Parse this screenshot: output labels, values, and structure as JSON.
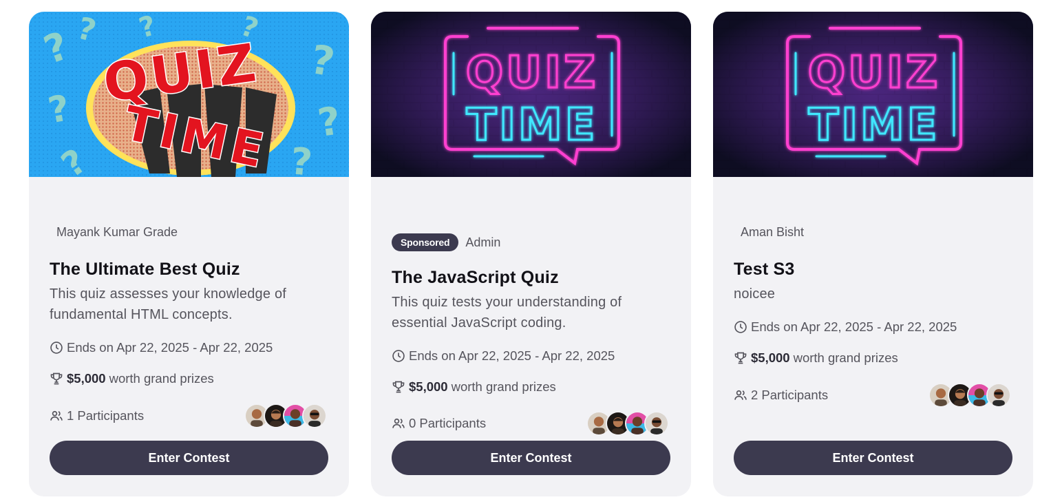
{
  "cards": [
    {
      "banner_style": "comic-blue",
      "banner_text_top": "QUIZ",
      "banner_text_bottom": "TIME",
      "sponsored": false,
      "sponsored_label": "",
      "author": "Mayank Kumar Grade",
      "title": "The Ultimate Best Quiz",
      "description": "This quiz assesses your knowledge of fundamental HTML concepts.",
      "ends_label": "Ends on Apr 22, 2025 - Apr 22, 2025",
      "prize_amount": "$5,000",
      "prize_suffix": "worth grand prizes",
      "participants_label": "1 Participants",
      "cta_label": "Enter Contest"
    },
    {
      "banner_style": "neon-brick",
      "banner_text_top": "QUIZ",
      "banner_text_bottom": "TIME",
      "sponsored": true,
      "sponsored_label": "Sponsored",
      "author": "Admin",
      "title": "The JavaScript Quiz",
      "description": "This quiz tests your understanding of essential JavaScript coding.",
      "ends_label": "Ends on Apr 22, 2025 - Apr 22, 2025",
      "prize_amount": "$5,000",
      "prize_suffix": "worth grand prizes",
      "participants_label": "0 Participants",
      "cta_label": "Enter Contest"
    },
    {
      "banner_style": "neon-brick",
      "banner_text_top": "QUIZ",
      "banner_text_bottom": "TIME",
      "sponsored": false,
      "sponsored_label": "",
      "author": "Aman Bisht",
      "title": "Test S3",
      "description": "noicee",
      "ends_label": "Ends on Apr 22, 2025 - Apr 22, 2025",
      "prize_amount": "$5,000",
      "prize_suffix": "worth grand prizes",
      "participants_label": "2 Participants",
      "cta_label": "Enter Contest"
    }
  ],
  "icons": {
    "ends": "clock-icon",
    "prize": "trophy-icon",
    "participants": "users-icon"
  },
  "colors": {
    "card_bg": "#f2f2f5",
    "button_bg": "#3c3a4f",
    "badge_bg": "#3c3a4f",
    "neon_pink": "#ff3fd0",
    "neon_cyan": "#3fe8ff",
    "comic_blue": "#29a4f0",
    "comic_red": "#e3141f"
  }
}
